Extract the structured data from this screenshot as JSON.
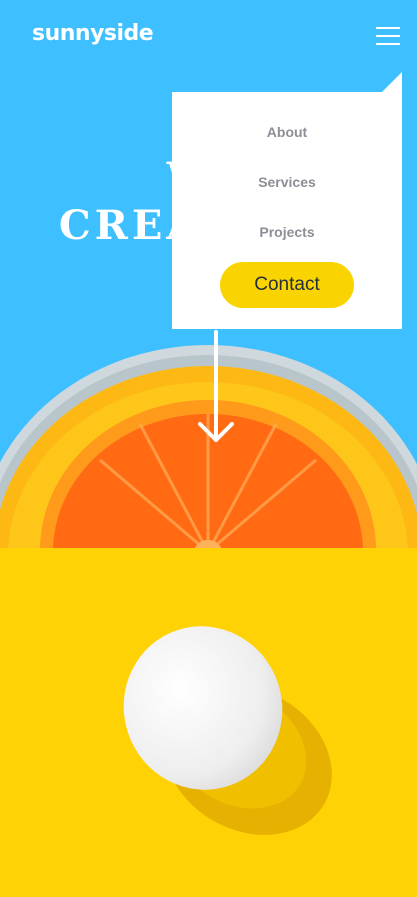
{
  "header": {
    "logo": "sunnyside",
    "menu_icon": "hamburger-menu-icon"
  },
  "hero": {
    "headline_line1": "WE",
    "headline_line2": "CREATIVES",
    "scroll_icon": "arrow-down-icon"
  },
  "nav_menu": {
    "items": [
      {
        "label": "About"
      },
      {
        "label": "Services"
      },
      {
        "label": "Projects"
      }
    ],
    "contact_label": "Contact"
  },
  "colors": {
    "hero_bg": "#3ebfff",
    "yellow": "#ffd204",
    "menu_text": "#8e8e96",
    "contact_bg": "#fad400",
    "contact_text": "#23303e"
  }
}
